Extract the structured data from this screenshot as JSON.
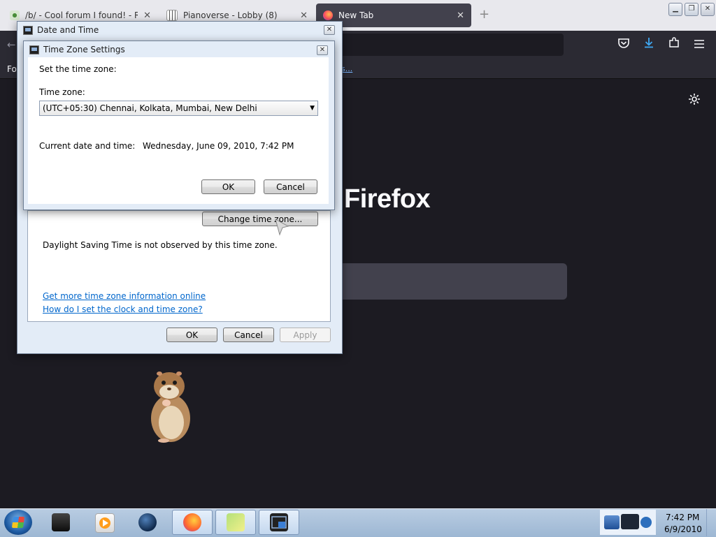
{
  "browser": {
    "tabs": [
      {
        "title": "/b/ - Cool forum I found! - Ran",
        "active": false
      },
      {
        "title": "Pianoverse - Lobby (8)",
        "active": false
      },
      {
        "title": "New Tab",
        "active": true
      }
    ],
    "new_tab_symbol": "+",
    "bookmarks_text": "Fo",
    "bookmarks_link": "s...",
    "brand_text": "Firefox"
  },
  "date_time_window": {
    "title": "Date and Time",
    "change_time_zone_label": "Change time zone...",
    "dst_note": "Daylight Saving Time is not observed by this time zone.",
    "link_more_info": "Get more time zone information online",
    "link_how_to": "How do I set the clock and time zone?",
    "ok_label": "OK",
    "cancel_label": "Cancel",
    "apply_label": "Apply"
  },
  "time_zone_dialog": {
    "title": "Time Zone Settings",
    "prompt": "Set the time zone:",
    "tz_label": "Time zone:",
    "tz_value": "(UTC+05:30) Chennai, Kolkata, Mumbai, New Delhi",
    "current_label": "Current date and time:",
    "current_value": "Wednesday, June 09, 2010, 7:42 PM",
    "ok_label": "OK",
    "cancel_label": "Cancel"
  },
  "taskbar": {
    "time": "7:42 PM",
    "date": "6/9/2010"
  },
  "colors": {
    "firefox_bg": "#1c1b22",
    "toolbar": "#2b2a33",
    "dialog_frame": "#e3ecf7",
    "link": "#0066cc",
    "taskbar": "#b8cce2"
  }
}
